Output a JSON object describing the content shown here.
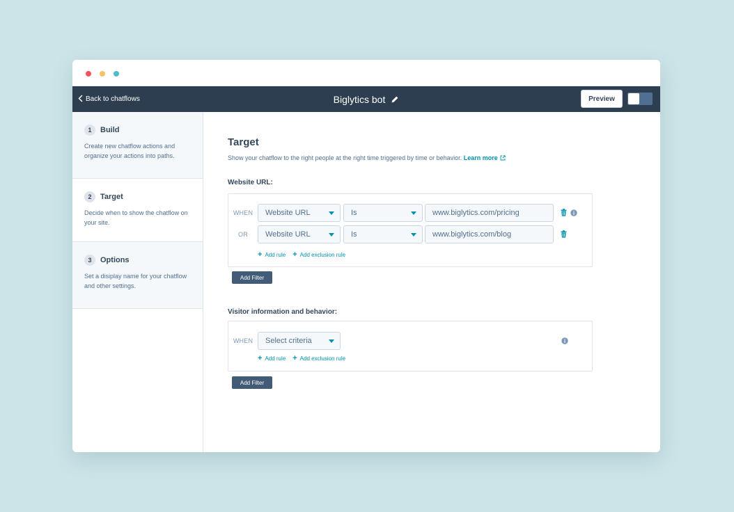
{
  "window": {
    "back_label": "Back to chatflows",
    "bot_title": "Biglytics bot",
    "preview_label": "Preview"
  },
  "steps": [
    {
      "number": "1",
      "title": "Build",
      "description": "Create new chatflow actions and organize your actions into paths."
    },
    {
      "number": "2",
      "title": "Target",
      "description": "Decide when to show the chatflow on your site."
    },
    {
      "number": "3",
      "title": "Options",
      "description": "Set a disiplay name for your chatflow and other settings."
    }
  ],
  "main": {
    "title": "Target",
    "subtitle": "Show your chatflow to the right people at the right time triggered by time or behavior.",
    "learn_more": "Learn more"
  },
  "website_url": {
    "title": "Website URL:",
    "rows": [
      {
        "operator": "WHEN",
        "field": "Website URL",
        "condition": "Is",
        "value": "www.biglytics.com/pricing"
      },
      {
        "operator": "OR",
        "field": "Website URL",
        "condition": "Is",
        "value": "www.biglytics.com/blog"
      }
    ],
    "add_rule": "Add rule",
    "add_exclusion_rule": "Add exclusion rule",
    "add_filter": "Add Filter"
  },
  "visitor": {
    "title": "Visitor information and behavior:",
    "operator": "WHEN",
    "criteria": "Select criteria",
    "add_rule": "Add rule",
    "add_exclusion_rule": "Add exclusion rule",
    "add_filter": "Add Filter"
  },
  "colors": {
    "topbar": "#2d3e50",
    "accent": "#0091ae",
    "button_dark": "#425b76",
    "background": "#cce4e8"
  }
}
